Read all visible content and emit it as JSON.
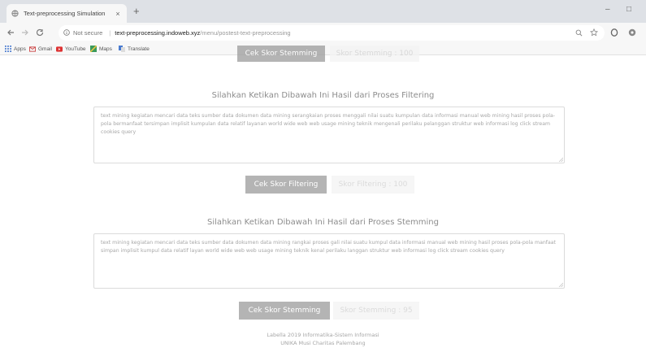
{
  "browser": {
    "tab_title": "Text-preprocessing Simulation",
    "tab_close": "×",
    "new_tab": "+",
    "url_secure_label": "Not secure",
    "url_divider": "|",
    "url_host": "text-preprocessing.indoweb.xyz",
    "url_path": "/menu/postest-text-preprocessing",
    "window_controls": {
      "minimize": "–",
      "maximize": "□"
    },
    "bookmarks": [
      "Apps",
      "Gmail",
      "YouTube",
      "Maps",
      "Translate"
    ]
  },
  "page": {
    "top_buttons": {
      "check_label": "Cek Skor Stemming",
      "score_label": "Skor Stemming : 100"
    },
    "filtering": {
      "title": "Silahkan Ketikan Dibawah Ini Hasil dari Proses Filtering",
      "text": "text mining kegiatan      mencari data  teks sumber data  dokumen data mining serangkaian proses menggali nilai   suatu kumpulan data  informasi  manual web mining hasil proses  pola-pola  bermanfaat  tersimpan  implisit  kumpulan data  relatif   layanan world wide web web usage mining teknik mengenali perilaku pelanggan struktur web  informasi   log click stream cookies query",
      "check_label": "Cek Skor Filtering",
      "score_label": "Skor Filtering : 100"
    },
    "stemming": {
      "title": "Silahkan Ketikan Dibawah Ini Hasil dari Proses Stemming",
      "text": "text mining kegiatan      mencari data   teks sumber data   dokumen data mining rangkai proses gali nilai   suatu kumpul data  informasi      manual web mining hasil proses  pola-pola  manfaat  simpan  implisit  kumpul data  relatif   layan world wide web web usage mining teknik kenal perilaku langgan struktur web  informasi   log click stream cookies query",
      "check_label": "Cek Skor Stemming",
      "score_label": "Skor Stemming : 95"
    },
    "footer": {
      "line1": "Labella 2019 Informatika-Sistem Informasi",
      "line2": "UNIKA Musi Charitas Palembang"
    }
  },
  "colors": {
    "primary_button": "#9c9c9c",
    "score_button": "#f4f4f4",
    "tabbar": "#dee1e6"
  }
}
